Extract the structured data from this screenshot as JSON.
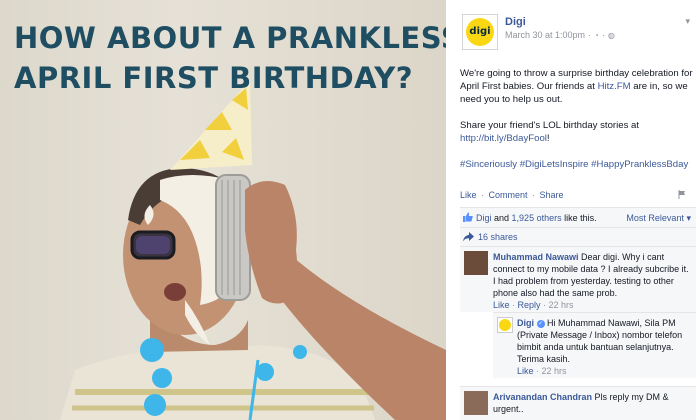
{
  "image": {
    "headline": [
      "HOW ABOUT A PRANKLESS",
      "APRIL FIRST BIRTHDAY?"
    ]
  },
  "post": {
    "page_name": "Digi",
    "logo_text": "digi",
    "timestamp": "March 30 at 1:00pm",
    "body": {
      "p1_before": "We're going to throw a surprise birthday celebration for April First babies. Our friends at ",
      "p1_link": "Hitz.FM",
      "p1_after": " are in, so we need you to help us out.",
      "p2_before": "Share your friend's LOL birthday stories at ",
      "p2_link": "http://bit.ly/BdayFool",
      "p2_after": "!",
      "hashtags": "#Sinceriously #DigiLetsInspire #HappyPranklessBday"
    },
    "actions": [
      "Like",
      "Comment",
      "Share"
    ],
    "likes": {
      "name": "Digi",
      "and": " and ",
      "others": "1,925 others",
      "suffix": " like this."
    },
    "sort_label": "Most Relevant",
    "shares": "16 shares"
  },
  "comments": [
    {
      "author": "Muhammad Nawawi",
      "text": "Dear digi. Why i cant connect to my mobile data ? I already subcribe it. I had problem from yesterday. testing to other phone also had the same prob.",
      "like": "Like",
      "reply": "Reply",
      "time": "22 hrs",
      "reply_item": {
        "author": "Digi",
        "text": "Hi Muhammad Nawawi, Sila PM (Private Message / Inbox) nombor telefon bimbit anda untuk bantuan selanjutnya. Terima kasih.",
        "like": "Like",
        "time": "22 hrs"
      }
    },
    {
      "author": "Arivanandan Chandran",
      "text": "Pls reply my DM & urgent.."
    }
  ],
  "colors": {
    "link": "#3b5998",
    "headline": "#1f4e63",
    "digi_yellow": "#f9d813",
    "meta_grey": "#90949c"
  },
  "icons": [
    "globe-icon",
    "clock-icon",
    "chevron-down-icon",
    "flag-icon",
    "like-icon",
    "share-icon",
    "verified-icon"
  ]
}
